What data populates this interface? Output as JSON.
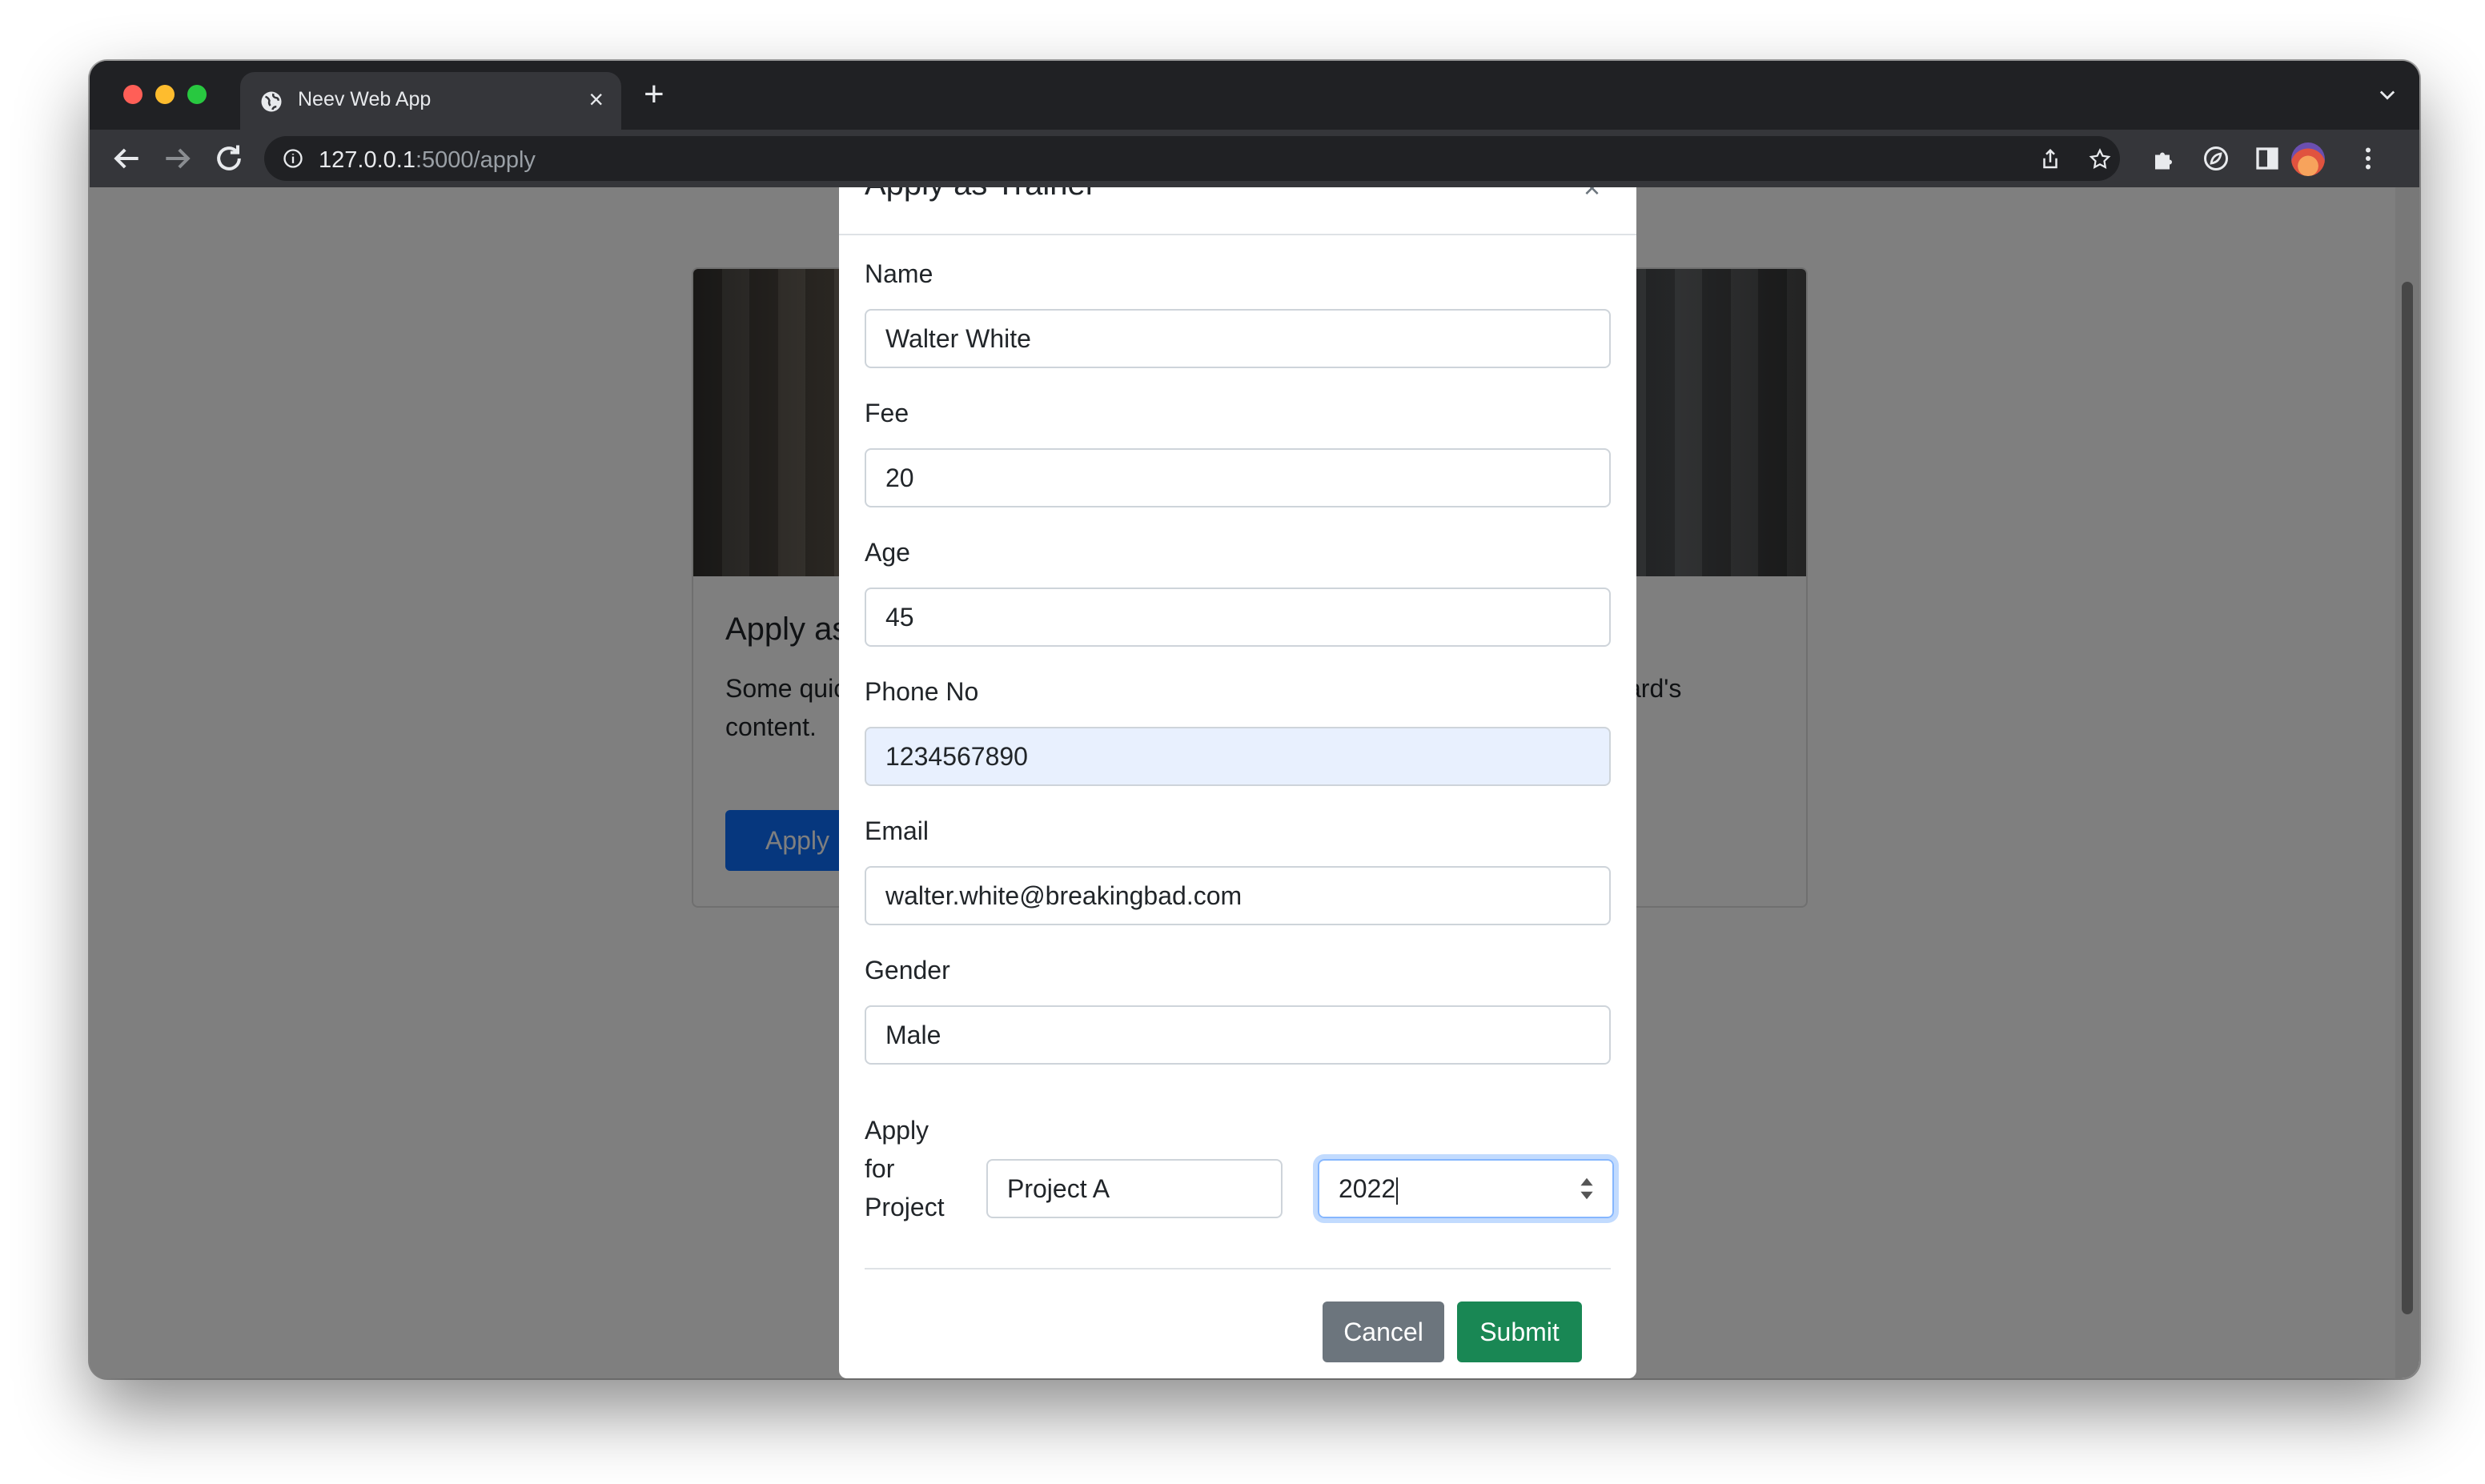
{
  "browser": {
    "tab_title": "Neev Web App",
    "tab_close": "×",
    "new_tab": "+",
    "url_host": "127.0.0.1",
    "url_path": ":5000/apply"
  },
  "card": {
    "title": "Apply as Trainer",
    "text": "Some quick example text to build on the card title and make up the bulk of the card's content.",
    "button": "Apply"
  },
  "modal": {
    "title": "Apply as Trainer",
    "close": "×",
    "fields": {
      "name_label": "Name",
      "name_value": "Walter White",
      "fee_label": "Fee",
      "fee_value": "20",
      "age_label": "Age",
      "age_value": "45",
      "phone_label": "Phone No",
      "phone_value": "1234567890",
      "email_label": "Email",
      "email_value": "walter.white@breakingbad.com",
      "gender_label": "Gender",
      "gender_value": "Male",
      "project_label": "Apply for Project",
      "project_value": "Project A",
      "year_value": "2022"
    },
    "cancel": "Cancel",
    "submit": "Submit"
  },
  "colors": {
    "primary": "#0d6efd",
    "secondary": "#6c757d",
    "success": "#198754",
    "autofill": "#e8f0fe"
  },
  "icons": [
    "globe-icon",
    "back-icon",
    "forward-icon",
    "reload-icon",
    "info-icon",
    "share-icon",
    "star-icon",
    "extensions-icon",
    "extension-leaf-icon",
    "sidebar-icon",
    "profile-avatar",
    "kebab-menu-icon",
    "chevron-down-icon",
    "spinner-icon"
  ]
}
